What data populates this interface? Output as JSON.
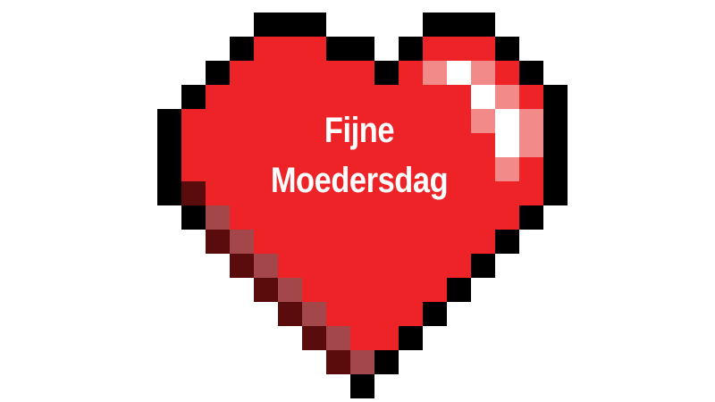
{
  "greeting": {
    "line1": "Fijne",
    "line2": "Moedersdag"
  },
  "colors": {
    "background": "#ffffff",
    "outline": "#000000",
    "fill": "#ee2328",
    "highlight": "#ffffff",
    "highlight_soft": "#f38a8a",
    "shadow_dark": "#5a0b0c",
    "shadow_mid": "#a3474a"
  },
  "icon": "pixel-heart-icon"
}
